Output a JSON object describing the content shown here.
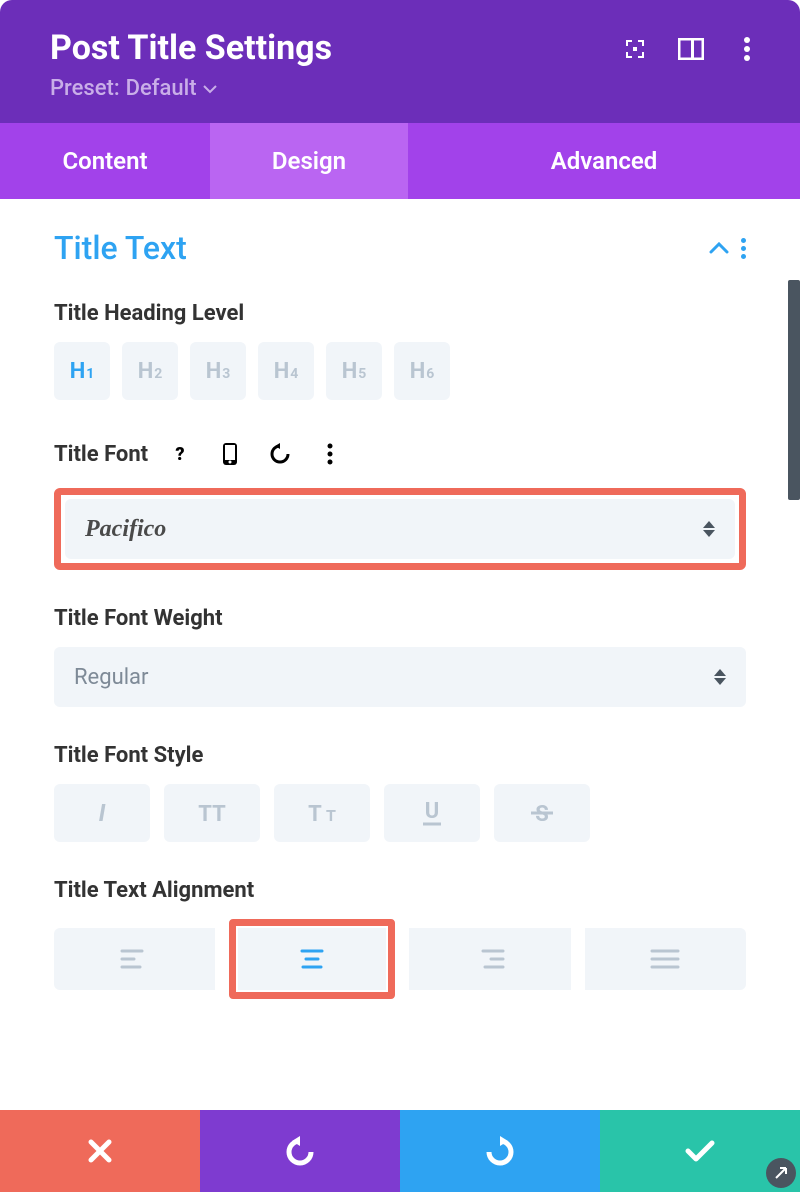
{
  "header": {
    "title": "Post Title Settings",
    "preset_label": "Preset:",
    "preset_value": "Default"
  },
  "tabs": {
    "content": "Content",
    "design": "Design",
    "advanced": "Advanced",
    "active": "Design"
  },
  "section": {
    "title": "Title Text"
  },
  "heading_level": {
    "label": "Title Heading Level",
    "options": [
      "H1",
      "H2",
      "H3",
      "H4",
      "H5",
      "H6"
    ],
    "active": "H1"
  },
  "font": {
    "label": "Title Font",
    "value": "Pacifico"
  },
  "font_weight": {
    "label": "Title Font Weight",
    "value": "Regular"
  },
  "font_style": {
    "label": "Title Font Style"
  },
  "alignment": {
    "label": "Title Text Alignment",
    "active": "center"
  }
}
